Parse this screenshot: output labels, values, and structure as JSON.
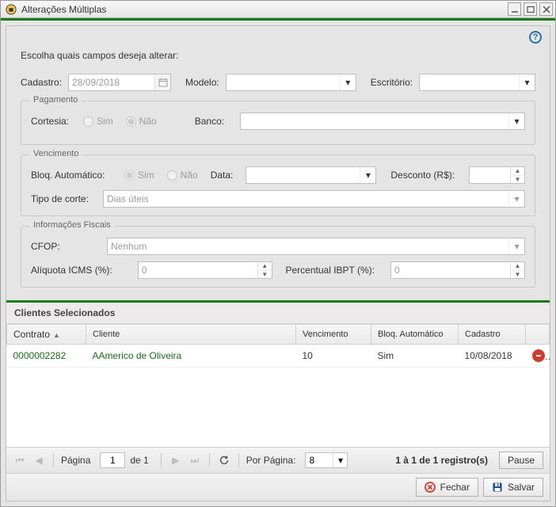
{
  "window": {
    "title": "Alterações Múltiplas"
  },
  "prompt": "Escolha quais campos deseja alterar:",
  "top": {
    "cadastro_label": "Cadastro:",
    "cadastro_value": "28/09/2018",
    "modelo_label": "Modelo:",
    "modelo_value": "",
    "escritorio_label": "Escritório:",
    "escritorio_value": ""
  },
  "pagamento": {
    "legend": "Pagamento",
    "cortesia_label": "Cortesia:",
    "sim_label": "Sim",
    "nao_label": "Não",
    "banco_label": "Banco:",
    "banco_value": ""
  },
  "vencimento": {
    "legend": "Vencimento",
    "bloq_label": "Bloq. Automático:",
    "sim_label": "Sim",
    "nao_label": "Não",
    "data_label": "Data:",
    "data_value": "",
    "desconto_label": "Desconto (R$):",
    "desconto_value": "",
    "tipo_label": "Tipo de corte:",
    "tipo_value": "Dias úteis"
  },
  "fiscais": {
    "legend": "Informações Fiscais",
    "cfop_label": "CFOP:",
    "cfop_value": "Nenhum",
    "icms_label": "Alíquota ICMS (%):",
    "icms_value": "0",
    "ibpt_label": "Percentual IBPT (%):",
    "ibpt_value": "0"
  },
  "clients_section": "Clientes Selecionados",
  "columns": {
    "contrato": "Contrato",
    "cliente": "Cliente",
    "vencimento": "Vencimento",
    "bloq": "Bloq. Automático",
    "cadastro": "Cadastro"
  },
  "rows": [
    {
      "contrato": "0000002282",
      "cliente": "AAmerico de Oliveira",
      "vencimento": "10",
      "bloq": "Sim",
      "cadastro": "10/08/2018"
    }
  ],
  "pager": {
    "page_label": "Página",
    "page_value": "1",
    "of_label": "de 1",
    "per_label": "Por Página:",
    "per_value": "8",
    "status": "1 à 1 de 1 registro(s)",
    "pause": "Pause"
  },
  "footer": {
    "close": "Fechar",
    "save": "Salvar"
  }
}
